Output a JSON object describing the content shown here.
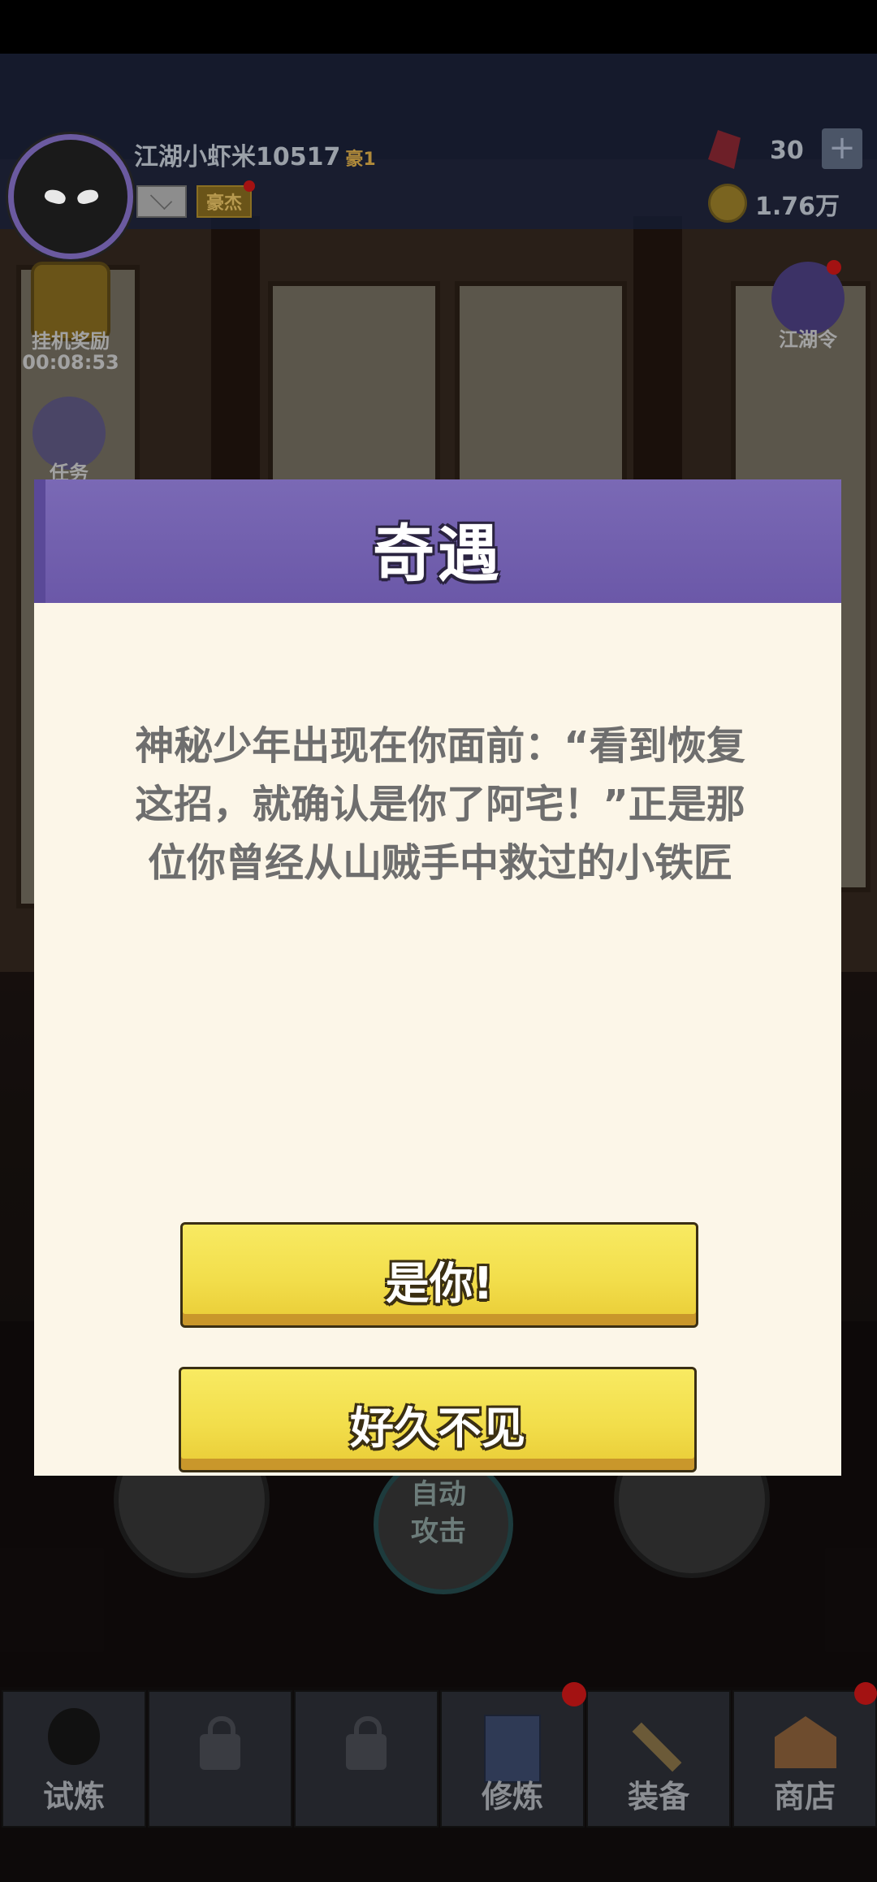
{
  "hud": {
    "player_name": "江湖小虾米10517",
    "rank": "豪1",
    "title_badge": "豪杰",
    "gems": "30",
    "plus": "+",
    "coins": "1.76万"
  },
  "side": {
    "idle_reward_label": "挂机奖励",
    "idle_timer": "00:08:53",
    "task_label": "任务",
    "jianghu_order_label": "江湖令"
  },
  "controls": {
    "auto_attack_line1": "自动",
    "auto_attack_line2": "攻击"
  },
  "tabs": [
    {
      "label": "试炼",
      "locked": false
    },
    {
      "label": "",
      "locked": true
    },
    {
      "label": "",
      "locked": true
    },
    {
      "label": "修炼",
      "locked": false
    },
    {
      "label": "装备",
      "locked": false
    },
    {
      "label": "商店",
      "locked": false
    }
  ],
  "dialog": {
    "title": "奇遇",
    "message": "神秘少年出现在你面前：“看到恢复这招，就确认是你了阿宅！”正是那位你曾经从山贼手中救过的小铁匠",
    "choice_1": "是你!",
    "choice_2": "好久不见"
  },
  "colors": {
    "header_purple": "#6b58a8",
    "body_cream": "#fcf6e8",
    "button_yellow": "#f2de4b",
    "text_gray": "#6e6e6e"
  }
}
